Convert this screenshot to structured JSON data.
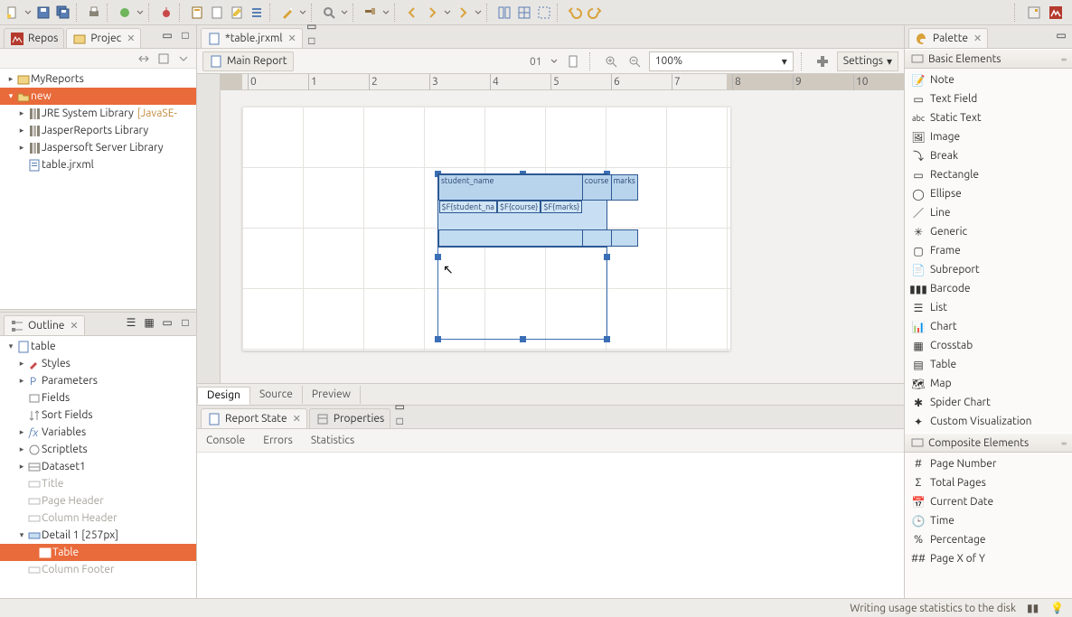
{
  "window": {
    "status": "Writing usage statistics to the disk"
  },
  "left": {
    "repos_tab": "Repos",
    "project_tab": "Projec",
    "tree": {
      "root": "MyReports",
      "folder_selected": "new",
      "items": [
        "JRE System Library",
        "JasperReports Library",
        "Jaspersoft Server Library",
        "table.jrxml"
      ],
      "jre_suffix": "[JavaSE-"
    },
    "outline_tab": "Outline",
    "outline": {
      "root": "table",
      "items": [
        "Styles",
        "Parameters",
        "Fields",
        "Sort Fields",
        "Variables",
        "Scriptlets",
        "Dataset1",
        "Title",
        "Page Header",
        "Column Header",
        "Detail 1 [257px]",
        "Table",
        "Column Footer"
      ]
    }
  },
  "editor": {
    "file_tab": "*table.jrxml",
    "main_report": "Main Report",
    "zoom": "100%",
    "settings": "Settings",
    "ruler_values": [
      "0",
      "1",
      "2",
      "3",
      "4",
      "5",
      "6",
      "7",
      "8",
      "9",
      "10"
    ],
    "bottom_tabs": [
      "Design",
      "Source",
      "Preview"
    ],
    "table": {
      "headers": [
        "student_name",
        "course",
        "marks"
      ],
      "fields": [
        "$F{student_na",
        "$F{course}",
        "$F{marks}"
      ]
    }
  },
  "console": {
    "tab1": "Report State",
    "tab2": "Properties",
    "subtabs": [
      "Console",
      "Errors",
      "Statistics"
    ]
  },
  "palette": {
    "title": "Palette",
    "group1": "Basic Elements",
    "group1_items": [
      "Note",
      "Text Field",
      "Static Text",
      "Image",
      "Break",
      "Rectangle",
      "Ellipse",
      "Line",
      "Generic",
      "Frame",
      "Subreport",
      "Barcode",
      "List",
      "Chart",
      "Crosstab",
      "Table",
      "Map",
      "Spider Chart",
      "Custom Visualization"
    ],
    "group2": "Composite Elements",
    "group2_items": [
      "Page Number",
      "Total Pages",
      "Current Date",
      "Time",
      "Percentage",
      "Page X of Y"
    ]
  }
}
